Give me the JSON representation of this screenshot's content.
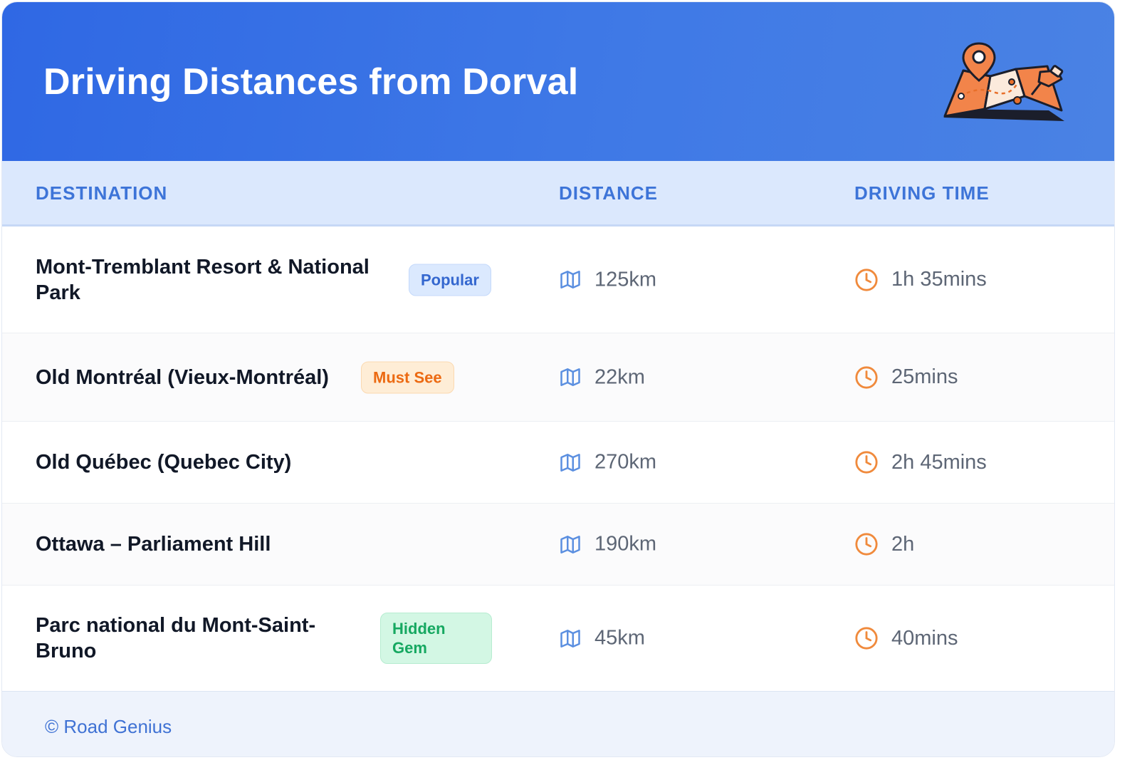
{
  "header": {
    "title": "Driving Distances from Dorval",
    "illustration": "folded-map-with-location-pin-icon"
  },
  "table": {
    "columns": [
      "DESTINATION",
      "DISTANCE",
      "DRIVING TIME"
    ],
    "rows": [
      {
        "destination": "Mont-Tremblant Resort & National Park",
        "badge": "Popular",
        "badge_color": "#3467cf",
        "distance": "125km",
        "time": "1h 35mins"
      },
      {
        "destination": "Old Montréal (Vieux-Montréal)",
        "badge": "Must See",
        "badge_color": "#ec6a12",
        "distance": "22km",
        "time": "25mins"
      },
      {
        "destination": "Old Québec (Quebec City)",
        "badge": "",
        "distance": "270km",
        "time": "2h 45mins"
      },
      {
        "destination": "Ottawa – Parliament Hill",
        "badge": "",
        "distance": "190km",
        "time": "2h"
      },
      {
        "destination": "Parc national du Mont-Saint-Bruno",
        "badge": "Hidden Gem",
        "badge_color": "#16a861",
        "distance": "45km",
        "time": "40mins"
      }
    ],
    "distance_icon": "map-icon",
    "time_icon": "clock-icon"
  },
  "footer": {
    "copyright": "© Road Genius"
  },
  "colors": {
    "header_bg": "#3170e5",
    "column_header_text": "#3d74d8",
    "distance_icon": "#5b8fe0",
    "clock_icon": "#f08a3c"
  }
}
